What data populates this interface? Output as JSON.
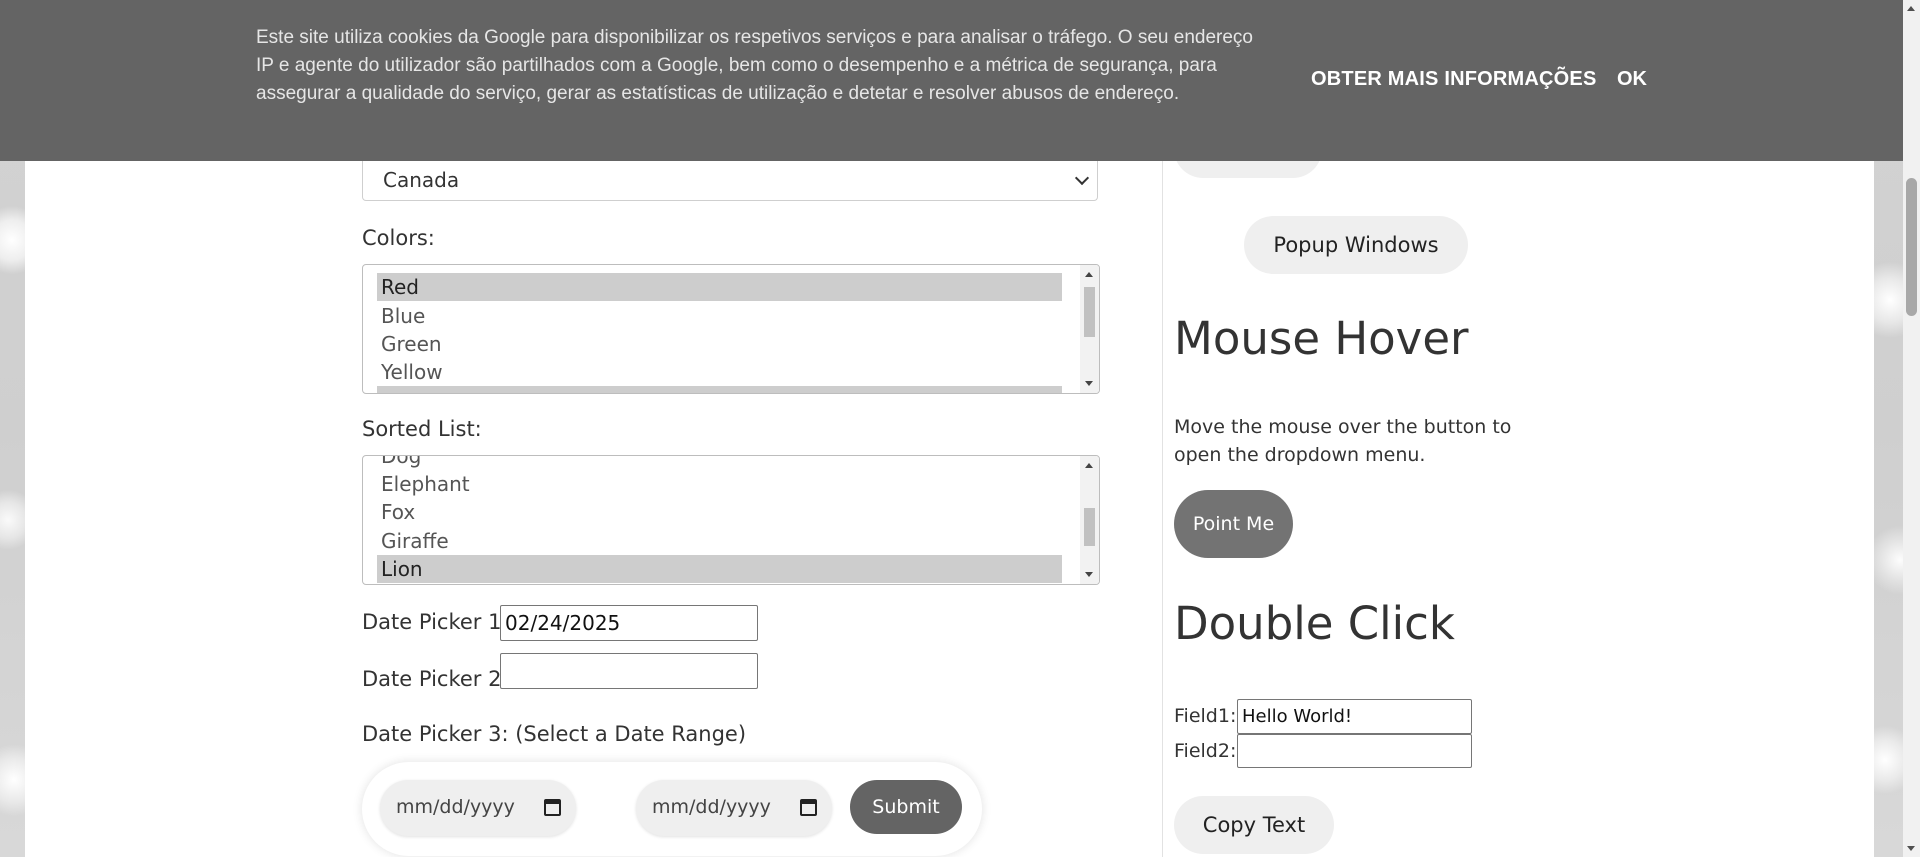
{
  "cookie": {
    "text": "Este site utiliza cookies da Google para disponibilizar os respetivos serviços e para analisar o tráfego. O seu endereço IP e agente do utilizador são partilhados com a Google, bem como o desempenho e a métrica de segurança, para assegurar a qualidade do serviço, gerar as estatísticas de utilização e detetar e resolver abusos de endereço.",
    "more_label": "OBTER MAIS INFORMAÇÕES",
    "ok_label": "OK"
  },
  "form": {
    "country_value": "Canada",
    "colors_label": "Colors:",
    "colors_options": [
      "Red",
      "Blue",
      "Green",
      "Yellow"
    ],
    "colors_selected": "Red",
    "sorted_label": "Sorted List:",
    "sorted_options": [
      "Dog",
      "Elephant",
      "Fox",
      "Giraffe",
      "Lion"
    ],
    "sorted_selected": "Lion",
    "date1_label": "Date Picker 1:",
    "date1_value": "02/24/2025",
    "date2_label": "Date Picker 2:",
    "date2_value": "",
    "date3_label": "Date Picker 3: (Select a Date Range)",
    "range_start_placeholder": "mm/dd/yyyy",
    "range_end_placeholder": "mm/dd/yyyy",
    "submit_label": "Submit"
  },
  "sidebar": {
    "popup_label": "Popup Windows",
    "mouse_hover_title": "Mouse Hover",
    "mouse_hover_desc": "Move the mouse over the button to open the dropdown menu.",
    "point_me_label": "Point Me",
    "double_click_title": "Double Click",
    "field1_label": "Field1:",
    "field1_value": "Hello World!",
    "field2_label": "Field2:",
    "field2_value": "",
    "copy_text_label": "Copy Text"
  },
  "colors": {
    "banner": "#646464",
    "selected_option": "#cdcdcd",
    "dark_button": "#646464"
  }
}
